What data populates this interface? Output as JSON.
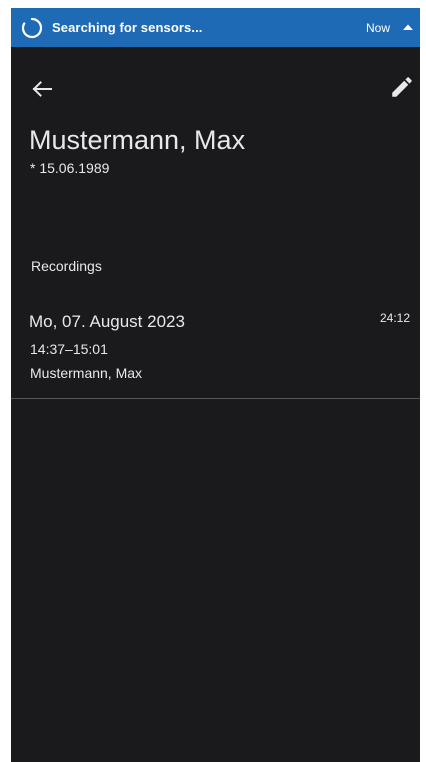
{
  "notification": {
    "text": "Searching for sensors...",
    "time": "Now",
    "spinner_icon": "loading-spinner-icon",
    "expand_icon": "chevron-up-icon",
    "background": "#1f6ab5"
  },
  "toolbar": {
    "back_icon": "arrow-left-icon",
    "edit_icon": "pencil-icon"
  },
  "patient": {
    "name": "Mustermann, Max",
    "dob": "* 15.06.1989"
  },
  "recordings": {
    "title": "Recordings",
    "items": [
      {
        "date": "Mo, 07. August 2023",
        "time_range": "14:37–15:01",
        "patient": "Mustermann, Max",
        "duration": "24:12"
      }
    ]
  },
  "colors": {
    "background": "#1a1a1d",
    "text": "#e8e8ea",
    "divider": "#55565a"
  }
}
